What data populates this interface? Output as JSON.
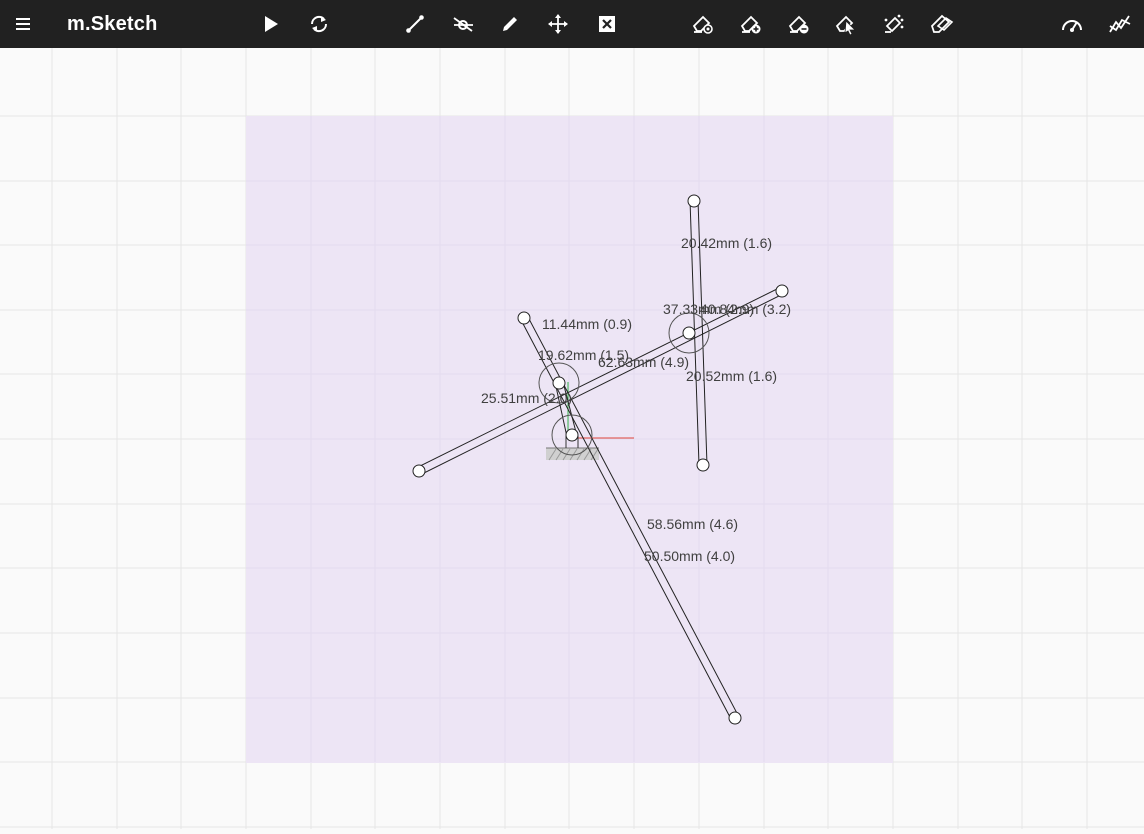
{
  "app": {
    "title": "m.Sketch"
  },
  "toolbar": {
    "left": [
      {
        "name": "menu-icon"
      }
    ],
    "run": [
      {
        "name": "play-icon"
      },
      {
        "name": "reset-icon"
      }
    ],
    "edit": [
      {
        "name": "link-tool-icon"
      },
      {
        "name": "fixed-node-tool-icon"
      },
      {
        "name": "pen-tool-icon"
      },
      {
        "name": "move-tool-icon"
      },
      {
        "name": "delete-tool-icon"
      }
    ],
    "modes": [
      {
        "name": "view-mode-icon"
      },
      {
        "name": "add-mode-icon"
      },
      {
        "name": "remove-mode-icon"
      },
      {
        "name": "select-mode-icon"
      },
      {
        "name": "drive-mode-icon"
      },
      {
        "name": "rotate-mode-icon"
      }
    ],
    "right": [
      {
        "name": "gauge-icon"
      },
      {
        "name": "chart-icon"
      }
    ]
  },
  "colors": {
    "toolbar_bg": "#212121",
    "canvas_bg": "#fafafa",
    "workspace_fill": "#ede5f5",
    "x_axis": "#e0453a",
    "y_axis": "#36b34a"
  },
  "dimensions": [
    {
      "text": "20.42mm (1.6)"
    },
    {
      "text": "37.33mm (2.9)"
    },
    {
      "text": "40.84mm (3.2)"
    },
    {
      "text": "11.44mm (0.9)"
    },
    {
      "text": "19.62mm (1.5)"
    },
    {
      "text": "62.63mm (4.9)"
    },
    {
      "text": "20.52mm (1.6)"
    },
    {
      "text": "25.51mm (2.0)"
    },
    {
      "text": "58.56mm (4.6)"
    },
    {
      "text": "50.50mm (4.0)"
    }
  ]
}
